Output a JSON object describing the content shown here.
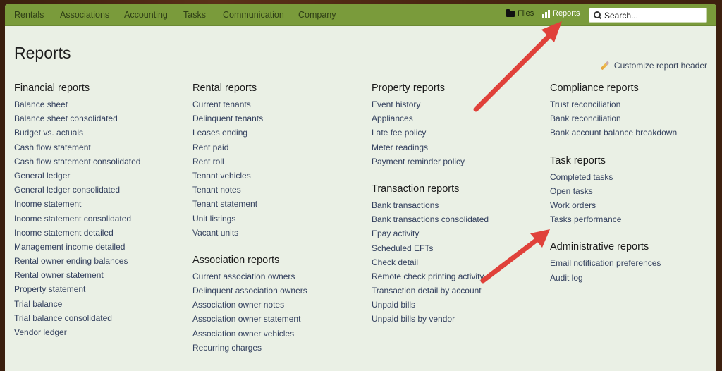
{
  "nav": {
    "items": [
      "Rentals",
      "Associations",
      "Accounting",
      "Tasks",
      "Communication",
      "Company"
    ],
    "files_label": "Files",
    "reports_label": "Reports",
    "search_placeholder": "Search..."
  },
  "page": {
    "title": "Reports",
    "customize_label": "Customize report header"
  },
  "columns": [
    {
      "sections": [
        {
          "title": "Financial reports",
          "items": [
            "Balance sheet",
            "Balance sheet consolidated",
            "Budget vs. actuals",
            "Cash flow statement",
            "Cash flow statement consolidated",
            "General ledger",
            "General ledger consolidated",
            "Income statement",
            "Income statement consolidated",
            "Income statement detailed",
            "Management income detailed",
            "Rental owner ending balances",
            "Rental owner statement",
            "Property statement",
            "Trial balance",
            "Trial balance consolidated",
            "Vendor ledger"
          ]
        }
      ]
    },
    {
      "sections": [
        {
          "title": "Rental reports",
          "items": [
            "Current tenants",
            "Delinquent tenants",
            "Leases ending",
            "Rent paid",
            "Rent roll",
            "Tenant vehicles",
            "Tenant notes",
            "Tenant statement",
            "Unit listings",
            "Vacant units"
          ]
        },
        {
          "title": "Association reports",
          "items": [
            "Current association owners",
            "Delinquent association owners",
            "Association owner notes",
            "Association owner statement",
            "Association owner vehicles",
            "Recurring charges"
          ]
        }
      ]
    },
    {
      "sections": [
        {
          "title": "Property reports",
          "items": [
            "Event history",
            "Appliances",
            "Late fee policy",
            "Meter readings",
            "Payment reminder policy"
          ]
        },
        {
          "title": "Transaction reports",
          "items": [
            "Bank transactions",
            "Bank transactions consolidated",
            "Epay activity",
            "Scheduled EFTs",
            "Check detail",
            "Remote check printing activity",
            "Transaction detail by account",
            "Unpaid bills",
            "Unpaid bills by vendor"
          ]
        }
      ]
    },
    {
      "sections": [
        {
          "title": "Compliance reports",
          "items": [
            "Trust reconciliation",
            "Bank reconciliation",
            "Bank account balance breakdown"
          ]
        },
        {
          "title": "Task reports",
          "items": [
            "Completed tasks",
            "Open tasks",
            "Work orders",
            "Tasks performance"
          ]
        },
        {
          "title": "Administrative reports",
          "items": [
            "Email notification preferences",
            "Audit log"
          ]
        }
      ]
    }
  ],
  "colors": {
    "nav_bg": "#7a9b3b",
    "content_bg": "#eaf0e5",
    "link": "#33405e",
    "annotation_arrow": "#e0413a"
  }
}
